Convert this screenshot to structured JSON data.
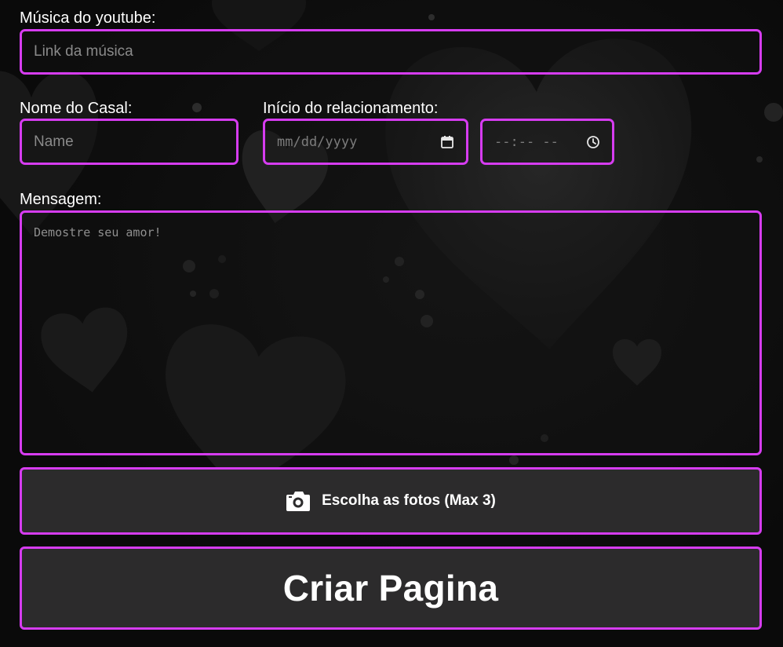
{
  "form": {
    "music": {
      "label": "Música do youtube:",
      "placeholder": "Link da música",
      "value": ""
    },
    "couple_name": {
      "label": "Nome do Casal:",
      "placeholder": "Name",
      "value": ""
    },
    "relationship_start": {
      "label": "Início do relacionamento:",
      "date_placeholder": "mm/dd/yyyy",
      "time_placeholder": "--:-- --",
      "date_icon": "calendar-icon",
      "time_icon": "clock-icon"
    },
    "message": {
      "label": "Mensagem:",
      "placeholder": "Demostre seu amor!",
      "value": ""
    },
    "photos_button": {
      "label": "Escolha as fotos (Max 3)",
      "icon": "camera-icon"
    },
    "create_button": {
      "label": "Criar Pagina"
    }
  },
  "theme": {
    "accent": "#d63cf0",
    "background": "#0b0b0b",
    "button_bg": "#2c2b2c",
    "text": "#ffffff",
    "placeholder": "#8a8a8a"
  },
  "background": {
    "decoration": "hearts-pattern"
  }
}
